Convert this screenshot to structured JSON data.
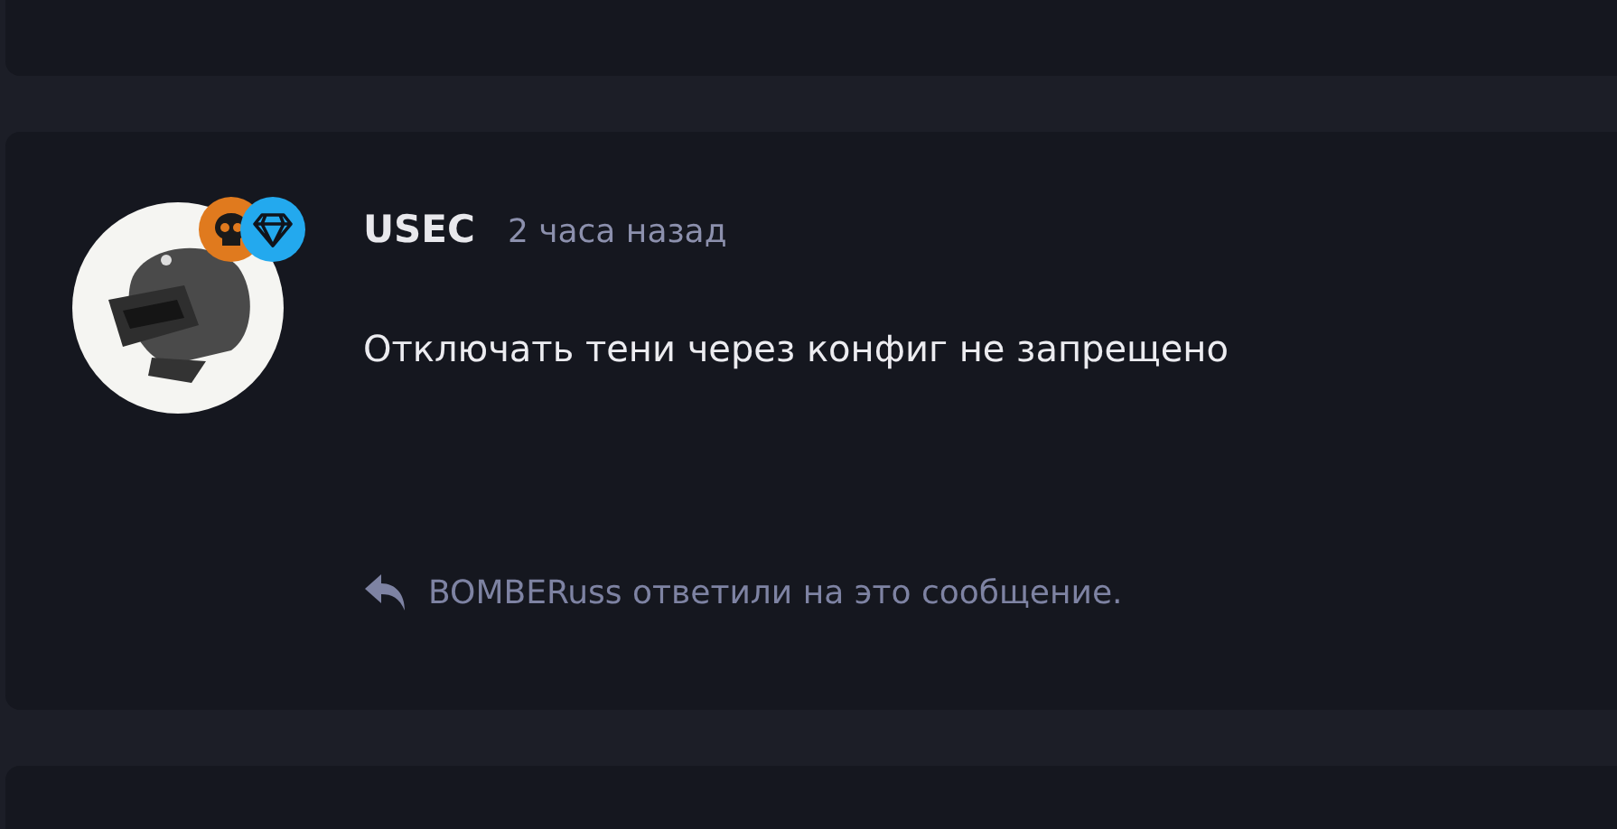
{
  "post": {
    "author": "USEC",
    "time": "2 часа назад",
    "message": "Отключать тени через конфиг не запрещено",
    "reply_note": "BOMBERuss ответили на это сообщение."
  }
}
